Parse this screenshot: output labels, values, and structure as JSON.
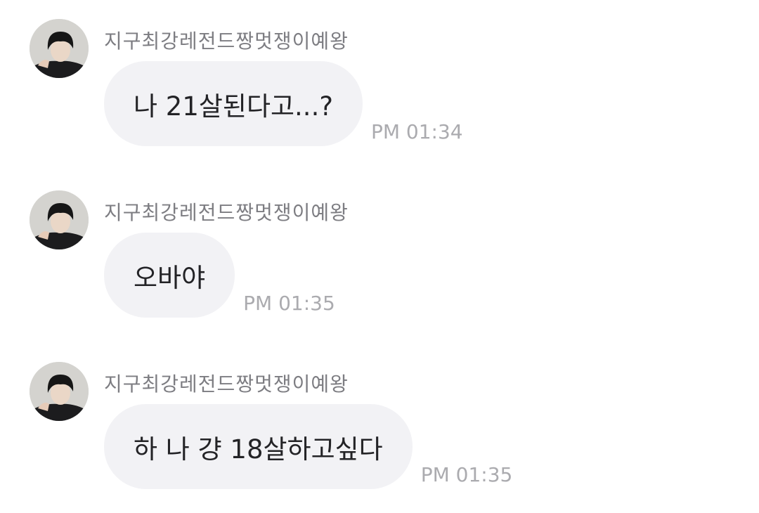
{
  "messages": [
    {
      "sender": "지구최강레전드짱멋쟁이예왕",
      "text": "나 21살된다고...?",
      "time": "PM 01:34"
    },
    {
      "sender": "지구최강레전드짱멋쟁이예왕",
      "text": "오바야",
      "time": "PM 01:35"
    },
    {
      "sender": "지구최강레전드짱멋쟁이예왕",
      "text": "하 나 걍 18살하고싶다",
      "time": "PM 01:35"
    }
  ],
  "colors": {
    "bubble": "#f2f2f5",
    "sender_text": "#7d7d82",
    "time_text": "#ababaf",
    "message_text": "#232326"
  }
}
